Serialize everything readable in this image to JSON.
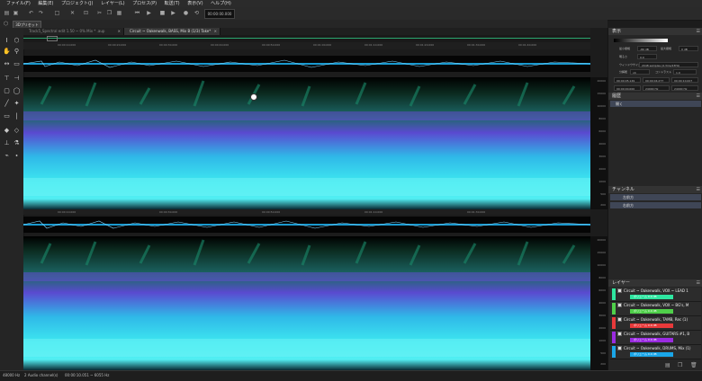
{
  "menu": [
    "ファイル(F)",
    "編集(E)",
    "プロジェクト(J)",
    "レイヤー(L)",
    "プロセス(P)",
    "転送(T)",
    "表示(V)",
    "ヘルプ(H)"
  ],
  "toolbar": {
    "time": "00:00:00.000"
  },
  "preset": "3Dプリセット",
  "tabs": [
    {
      "label": "Track5_Spectral edit 1.50 ~ 0% Mix * .aup",
      "active": false
    },
    {
      "label": "Circuit ~ Oakenwalk, BASS, Mix B (1/3) Take* ",
      "active": true
    }
  ],
  "ruler_labels": [
    "00:00:10.000",
    "00:00:20.000",
    "00:00:30.000",
    "00:00:40.000",
    "00:00:50.000",
    "00:01:00.000",
    "00:01:10.000",
    "00:01:20.000",
    "00:01:30.000",
    "00:01:40.000"
  ],
  "freq_scale": [
    "20000",
    "15000",
    "10000",
    "8000",
    "6000",
    "4000",
    "3000",
    "2000",
    "1000",
    "500",
    "200"
  ],
  "panel_display": {
    "title": "表示",
    "rows": [
      {
        "label": "最小振幅",
        "value": "-80 dB"
      },
      {
        "label": "最大振幅",
        "value": "0 dB"
      },
      {
        "label": "明るさ",
        "value": "0.0"
      },
      {
        "label": "ウィンドウサイズ",
        "value": "2048 samples (4.3ms/23Hz)"
      },
      {
        "label": "分解能",
        "value": "x4"
      },
      {
        "label": "コントラスト",
        "value": "1.0"
      }
    ],
    "readouts": [
      "00:00:05.149",
      "00:00:04.277",
      "00:00:10.007",
      "00:00:00.000",
      "24000 Hz",
      "24000 Hz"
    ]
  },
  "panel_history": {
    "title": "履歴",
    "item": "開く"
  },
  "panel_channels": {
    "title": "チャンネル",
    "items": [
      "左前方",
      "右前方"
    ]
  },
  "panel_layers": {
    "title": "レイヤー",
    "layers": [
      {
        "name": "Circuit ~ Oakenwalk, VOX ~ LEAD 1",
        "volume": "ボリューム 0.0 dB",
        "color": "#2ee6a0"
      },
      {
        "name": "Circuit ~ Oakenwalk, VOX ~ BG's, M",
        "volume": "ボリューム 0.0 dB",
        "color": "#4fd04a"
      },
      {
        "name": "Circuit ~ Oakenwalk, TAMB, Rec (1)",
        "volume": "ボリューム 0.0 dB",
        "color": "#e8393a"
      },
      {
        "name": "Circuit ~ Oakenwalk, GUITARS #1, B",
        "volume": "ボリューム 0.0 dB",
        "color": "#9a2be0"
      },
      {
        "name": "Circuit ~ Oakenwalk, DRUMS, Mix (1)",
        "volume": "ボリューム 0.0 dB",
        "color": "#1aa6e8"
      }
    ]
  },
  "status": [
    "48000 Hz",
    "2 Audio channel(s)",
    "00:00:10.051 ~ 6055 Hz"
  ],
  "colors": {
    "accent": "#3f4656",
    "spectral_cyan": "#38e8ee"
  }
}
